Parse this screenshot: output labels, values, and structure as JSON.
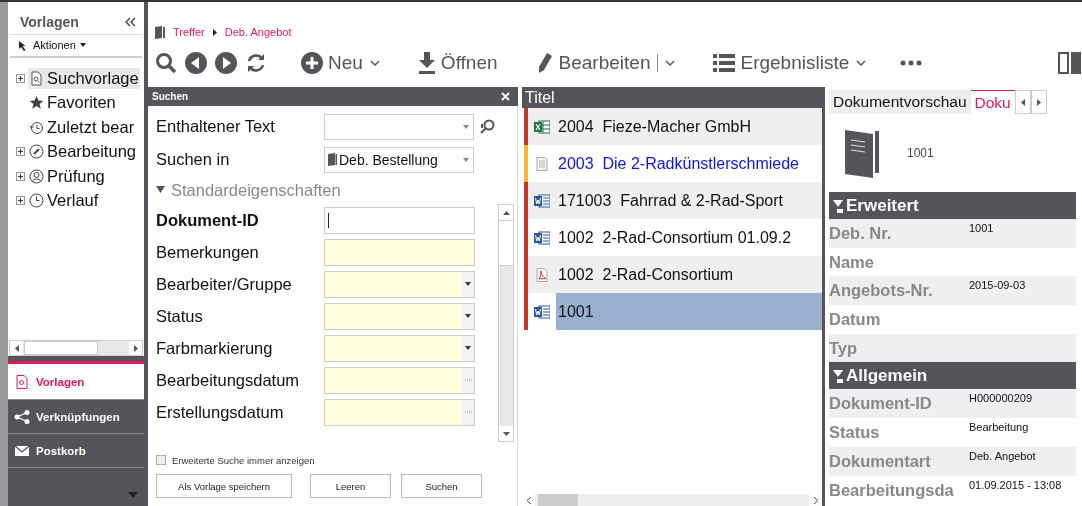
{
  "sidebar": {
    "title": "Vorlagen",
    "actions": "Aktionen",
    "tree": [
      {
        "label": "Suchvorlage",
        "kind": "search-doc",
        "expandable": true,
        "selected": true
      },
      {
        "label": "Favoriten",
        "kind": "star",
        "expandable": false,
        "selected": false
      },
      {
        "label": "Zuletzt bear",
        "kind": "history",
        "expandable": false,
        "selected": false
      },
      {
        "label": "Bearbeitung",
        "kind": "gauge",
        "expandable": true,
        "selected": false
      },
      {
        "label": "Prüfung",
        "kind": "person",
        "expandable": true,
        "selected": false
      },
      {
        "label": "Verlauf",
        "kind": "clock",
        "expandable": true,
        "selected": false
      }
    ],
    "nav": [
      {
        "label": "Vorlagen",
        "kind": "search-doc",
        "selected": true
      },
      {
        "label": "Verknüpfungen",
        "kind": "share",
        "selected": false
      },
      {
        "label": "Postkorb",
        "kind": "mail",
        "selected": false
      }
    ]
  },
  "breadcrumb": [
    "Treffer",
    "Deb. Angebot"
  ],
  "toolbar": [
    {
      "label": "Neu",
      "kind": "plus",
      "dropdown": true,
      "split": false
    },
    {
      "label": "Öffnen",
      "kind": "download",
      "dropdown": false,
      "split": false
    },
    {
      "label": "Bearbeiten",
      "kind": "pencil",
      "dropdown": true,
      "split": true
    },
    {
      "label": "Ergebnisliste",
      "kind": "list",
      "dropdown": true,
      "split": false
    }
  ],
  "search": {
    "title": "Suchen",
    "top_fields": [
      {
        "label": "Enthaltener Text",
        "kind": "combo"
      },
      {
        "label": "Suchen in",
        "kind": "combo",
        "value": "Deb. Bestellung"
      }
    ],
    "section": {
      "title": "Standardeigenschaften",
      "expanded": true
    },
    "fields": [
      {
        "label": "Dokument-ID",
        "kind": "text",
        "bold": true,
        "highlighted": false
      },
      {
        "label": "Bemerkungen",
        "kind": "text",
        "bold": false,
        "highlighted": true
      },
      {
        "label": "Bearbeiter/Gruppe",
        "kind": "dropdown",
        "bold": false,
        "highlighted": true
      },
      {
        "label": "Status",
        "kind": "dropdown",
        "bold": false,
        "highlighted": true
      },
      {
        "label": "Farbmarkierung",
        "kind": "dropdown",
        "bold": false,
        "highlighted": true
      },
      {
        "label": "Bearbeitungsdatum",
        "kind": "date",
        "bold": false,
        "highlighted": true
      },
      {
        "label": "Erstellungsdatum",
        "kind": "date",
        "bold": false,
        "highlighted": true
      }
    ],
    "checkbox": {
      "label": "Erweiterte Suche immer anzeigen",
      "checked": false
    },
    "buttons": [
      "Als Vorlage speichern",
      "Leeren",
      "Suchen"
    ]
  },
  "results": {
    "column": "Titel",
    "rows": [
      {
        "number": "2004",
        "title": "Fieze-Macher GmbH",
        "kind": "excel",
        "color": "#c0392b",
        "highlighted": false,
        "selected": false
      },
      {
        "number": "2003",
        "title": "Die 2-Radkünstlerschmiede",
        "kind": "note",
        "color": "#f5b82e",
        "highlighted": true,
        "selected": false
      },
      {
        "number": "171003",
        "title": "Fahrrad & 2-Rad-Sport",
        "kind": "word",
        "color": "#c0392b",
        "highlighted": false,
        "selected": false
      },
      {
        "number": "1002",
        "title": "2-Rad-Consortium  01.09.2",
        "kind": "word",
        "color": "#c0392b",
        "highlighted": false,
        "selected": false
      },
      {
        "number": "1002",
        "title": "2-Rad-Consortium",
        "kind": "pdf",
        "color": "#c0392b",
        "highlighted": false,
        "selected": false
      },
      {
        "number": "1001",
        "kind": "word",
        "color": "#c0392b",
        "highlighted": false,
        "selected": true
      }
    ]
  },
  "preview": {
    "tabs": [
      {
        "label": "Dokumentvorschau",
        "selected": false
      },
      {
        "label": "Doku",
        "selected": true
      }
    ],
    "document_number": "1001",
    "sections": [
      {
        "title": "Erweitert",
        "expanded": true,
        "properties": [
          {
            "label": "Deb. Nr.",
            "value": "1001"
          },
          {
            "label": "Name"
          },
          {
            "label": "Angebots-Nr.",
            "value": "2015-09-03"
          },
          {
            "label": "Datum"
          },
          {
            "label": "Typ"
          }
        ]
      },
      {
        "title": "Allgemein",
        "expanded": true,
        "properties": [
          {
            "label": "Dokument-ID",
            "value": "H000000209"
          },
          {
            "label": "Status",
            "value": "Bearbeitung"
          },
          {
            "label": "Dokumentart",
            "value": "Deb. Angebot"
          },
          {
            "label": "Bearbeitungsda",
            "value": "01.09.2015 - 13:08"
          }
        ]
      }
    ]
  }
}
